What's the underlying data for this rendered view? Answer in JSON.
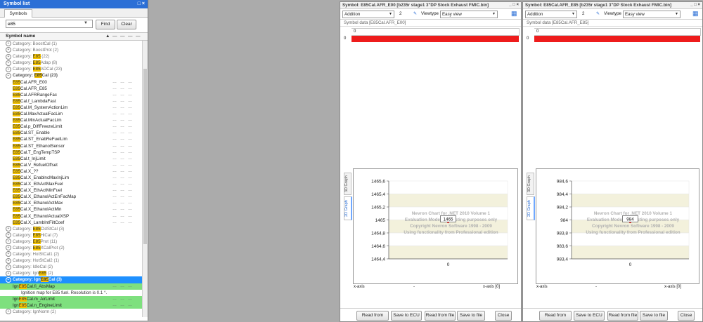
{
  "symbol_list": {
    "title": "Symbol list",
    "pin": "□ ×",
    "tab": "Symbols",
    "search_value": "e85",
    "find_label": "Find",
    "clear_label": "Clear",
    "column_header": "Symbol name",
    "rows": [
      {
        "kind": "cat",
        "pre": "Category: ",
        "hl": "",
        "post": "BoostCal (1)",
        "exp": "+"
      },
      {
        "kind": "cat",
        "pre": "Category: ",
        "hl": "",
        "post": "BoostProt (2)",
        "exp": "+"
      },
      {
        "kind": "cat",
        "pre": "Category: ",
        "hl": "E85",
        "post": " (22)",
        "exp": "+"
      },
      {
        "kind": "cat",
        "pre": "Category: ",
        "hl": "E85",
        "post": "Adap (8)",
        "exp": "+"
      },
      {
        "kind": "cat",
        "pre": "Category: ",
        "hl": "E85",
        "post": "ADCal (23)",
        "exp": "+"
      },
      {
        "kind": "catb",
        "pre": "Category: ",
        "hl": "E85",
        "post": "Cal (23)",
        "exp": "−"
      },
      {
        "kind": "item",
        "hl": "E85",
        "post": "Cal.AFR_E00"
      },
      {
        "kind": "item",
        "hl": "E85",
        "post": "Cal.AFR_E85"
      },
      {
        "kind": "item",
        "hl": "E85",
        "post": "Cal.AFRRangeFac"
      },
      {
        "kind": "item",
        "hl": "E85",
        "post": "Cal.f_LambdaFast"
      },
      {
        "kind": "item",
        "hl": "E85",
        "post": "Cal.M_SystemActionLim"
      },
      {
        "kind": "item",
        "hl": "E85",
        "post": "Cal.MaxActualFacLim"
      },
      {
        "kind": "item",
        "hl": "E85",
        "post": "Cal.MinActualFacLim"
      },
      {
        "kind": "item",
        "hl": "E85",
        "post": "Cal.p_DiffFreezeLimit"
      },
      {
        "kind": "item",
        "hl": "E85",
        "post": "Cal.ST_Enable"
      },
      {
        "kind": "item",
        "hl": "E85",
        "post": "Cal.ST_EnabReFuelLim"
      },
      {
        "kind": "item",
        "hl": "E85",
        "post": "Cal.ST_EthanolSensor"
      },
      {
        "kind": "item",
        "hl": "E85",
        "post": "Cal.T_EngTempTSP"
      },
      {
        "kind": "item",
        "hl": "E85",
        "post": "Cal.t_InjLimit"
      },
      {
        "kind": "item",
        "hl": "E85",
        "post": "Cal.V_RefuelOffset"
      },
      {
        "kind": "item",
        "hl": "E85",
        "post": "Cal.X_??"
      },
      {
        "kind": "item",
        "hl": "E85",
        "post": "Cal.X_EnablncMaxInjLim"
      },
      {
        "kind": "item",
        "hl": "E85",
        "post": "Cal.X_EthActMaxFuel"
      },
      {
        "kind": "item",
        "hl": "E85",
        "post": "Cal.X_EthActMinFuel"
      },
      {
        "kind": "item",
        "hl": "E85",
        "post": "Cal.X_EthanolActErrFacMap"
      },
      {
        "kind": "item",
        "hl": "E85",
        "post": "Cal.X_EthanolActMax"
      },
      {
        "kind": "item",
        "hl": "E85",
        "post": "Cal.X_EthanolActMin"
      },
      {
        "kind": "item",
        "hl": "E85",
        "post": "Cal.X_EthanolActualXSP"
      },
      {
        "kind": "item",
        "hl": "E85",
        "post": "Cal.X_LambIntFiltCoef"
      },
      {
        "kind": "cat",
        "pre": "Category: ",
        "hl": "E85",
        "post": "CldStCal (3)",
        "exp": "+"
      },
      {
        "kind": "cat",
        "pre": "Category: ",
        "hl": "E85",
        "post": "HiCal (7)",
        "exp": "+"
      },
      {
        "kind": "cat",
        "pre": "Category: ",
        "hl": "E85",
        "post": "Prot (11)",
        "exp": "+"
      },
      {
        "kind": "cat",
        "pre": "Category: ",
        "hl": "E85",
        "post": "XCalProt (2)",
        "exp": "+"
      },
      {
        "kind": "cat",
        "pre": "Category: ",
        "hl": "",
        "post": "HotStCal1 (2)",
        "exp": "+"
      },
      {
        "kind": "cat",
        "pre": "Category: ",
        "hl": "",
        "post": "HotStCal2 (1)",
        "exp": "+"
      },
      {
        "kind": "cat",
        "pre": "Category: ",
        "hl": "",
        "post": "IdleCal (2)",
        "exp": "+"
      },
      {
        "kind": "cat",
        "pre": "Category: Ign",
        "hl": "E85",
        "post": " (2)",
        "exp": "+"
      },
      {
        "kind": "selcat",
        "pre": "Category: Ign",
        "hl": "E85",
        "post": "Cal (3)",
        "exp": "−"
      },
      {
        "kind": "green",
        "pre": "Ign",
        "hl": "E85",
        "post": "Cal.fi_AbsMap"
      },
      {
        "kind": "desc",
        "post": "Ignition map for E85 fuel. Resolution is 0.1 °."
      },
      {
        "kind": "green",
        "pre": "Ign",
        "hl": "E85",
        "post": "Cal.m_AirLimit"
      },
      {
        "kind": "green",
        "pre": "Ign",
        "hl": "E85",
        "post": "Cal.n_EngineLimit"
      },
      {
        "kind": "cat",
        "pre": "Category: ",
        "hl": "",
        "post": "IgnNorm (2)",
        "exp": "+"
      }
    ]
  },
  "windows": [
    {
      "title": "Symbol: E85Cal.AFR_E00 [b235r stage1 3\"DP Stock Exhaust FMIC.bin]",
      "ctrl": "_ □ ×",
      "mode": "Addition",
      "mode_value": "2",
      "viewtype_label": "Viewtype",
      "viewtype": "Easy view",
      "section": "Symbol data [E85Cal.AFR_E00]",
      "col_header": "0",
      "row_header": "0",
      "tab_3d": "3D Graph",
      "tab_2d": "2D Graph",
      "watermark": [
        "Nevron Chart for .NET 2010 Volume 1",
        "Evaluation Mode - for testing purposes only",
        "Copyright Nevron Software 1998 - 2009",
        "Using functionality from Professional edition"
      ],
      "xaxis_left": "x-axis",
      "xaxis_right": "x-axis [0]",
      "xaxis_mid": "-",
      "buttons": [
        "Read from ECU",
        "Save to ECU",
        "Read from file",
        "Save to file",
        "Close"
      ]
    },
    {
      "title": "Symbol: E85Cal.AFR_E85 [b235r stage1 3\"DP Stock Exhaust FMIC.bin]",
      "ctrl": "_ □ ×",
      "mode": "Addition",
      "mode_value": "2",
      "viewtype_label": "Viewtype",
      "viewtype": "Easy view",
      "section": "Symbol data [E85Cal.AFR_E85]",
      "col_header": "0",
      "row_header": "0",
      "tab_3d": "3D Graph",
      "tab_2d": "2D Graph",
      "watermark": [
        "Nevron Chart for .NET 2010 Volume 1",
        "Evaluation Mode - for testing purposes only",
        "Copyright Nevron Software 1998 - 2009",
        "Using functionality from Professional edition"
      ],
      "xaxis_left": "x-axis",
      "xaxis_right": "x-axis [0]",
      "xaxis_mid": "-",
      "buttons": [
        "Read from ECU",
        "Save to ECU",
        "Read from file",
        "Save to file",
        "Close"
      ]
    }
  ],
  "chart_data": [
    {
      "type": "line",
      "x": [
        0
      ],
      "values": [
        1465
      ],
      "point_label": "1465",
      "ylim": [
        1464.4,
        1465.6
      ],
      "yticks": [
        "1465,6",
        "1465,4",
        "1465,2",
        "1465",
        "1464,8",
        "1464,6",
        "1464,4"
      ],
      "xticks": [
        "0"
      ]
    },
    {
      "type": "line",
      "x": [
        0
      ],
      "values": [
        984
      ],
      "point_label": "984",
      "ylim": [
        983.4,
        984.6
      ],
      "yticks": [
        "984,6",
        "984,4",
        "984,2",
        "984",
        "983,8",
        "983,6",
        "983,4"
      ],
      "xticks": [
        "0"
      ]
    }
  ],
  "colors": {
    "accent": "#2b6fd6",
    "highlight": "#f5c400",
    "selected": "#1e90ff",
    "green": "#7ee07e",
    "red": "#ee1c1c",
    "band": "#f3f1dc"
  }
}
